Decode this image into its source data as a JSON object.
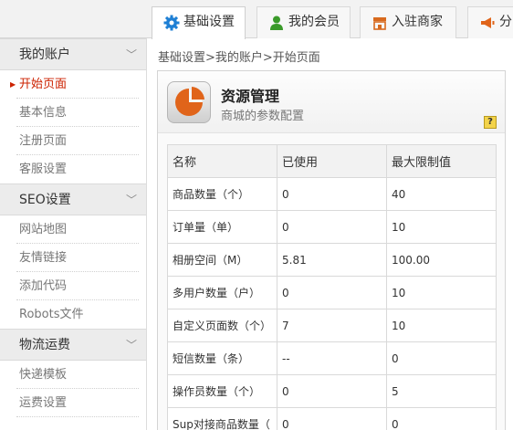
{
  "tabs": [
    {
      "label": "基础设置",
      "icon": "gear-icon",
      "active": true
    },
    {
      "label": "我的会员",
      "icon": "user-icon",
      "active": false
    },
    {
      "label": "入驻商家",
      "icon": "store-icon",
      "active": false
    },
    {
      "label": "分",
      "icon": "megaphone-icon",
      "active": false
    }
  ],
  "sidebar": {
    "groups": [
      {
        "title": "我的账户",
        "items": [
          "开始页面",
          "基本信息",
          "注册页面",
          "客服设置"
        ]
      },
      {
        "title": "SEO设置",
        "items": [
          "网站地图",
          "友情链接",
          "添加代码",
          "Robots文件"
        ]
      },
      {
        "title": "物流运费",
        "items": [
          "快递模板",
          "运费设置",
          "..."
        ]
      }
    ],
    "active_item": "开始页面"
  },
  "breadcrumb": "基础设置>我的账户>开始页面",
  "panel": {
    "title": "资源管理",
    "subtitle": "商城的参数配置",
    "help": "?"
  },
  "table": {
    "headers": [
      "名称",
      "已使用",
      "最大限制值"
    ],
    "rows": [
      [
        "商品数量（个）",
        "0",
        "40"
      ],
      [
        "订单量（单）",
        "0",
        "10"
      ],
      [
        "相册空间（M）",
        "5.81",
        "100.00"
      ],
      [
        "多用户数量（户）",
        "0",
        "10"
      ],
      [
        "自定义页面数（个）",
        "7",
        "10"
      ],
      [
        "短信数量（条）",
        "--",
        "0"
      ],
      [
        "操作员数量（个）",
        "0",
        "5"
      ],
      [
        "Sup对接商品数量（",
        "0",
        "0"
      ]
    ]
  },
  "colors": {
    "accent_red": "#cc2200",
    "gear_blue": "#1e7fd4",
    "user_green": "#3a9a2a",
    "store_orange": "#d86a1e",
    "pie_orange": "#e0641a"
  }
}
